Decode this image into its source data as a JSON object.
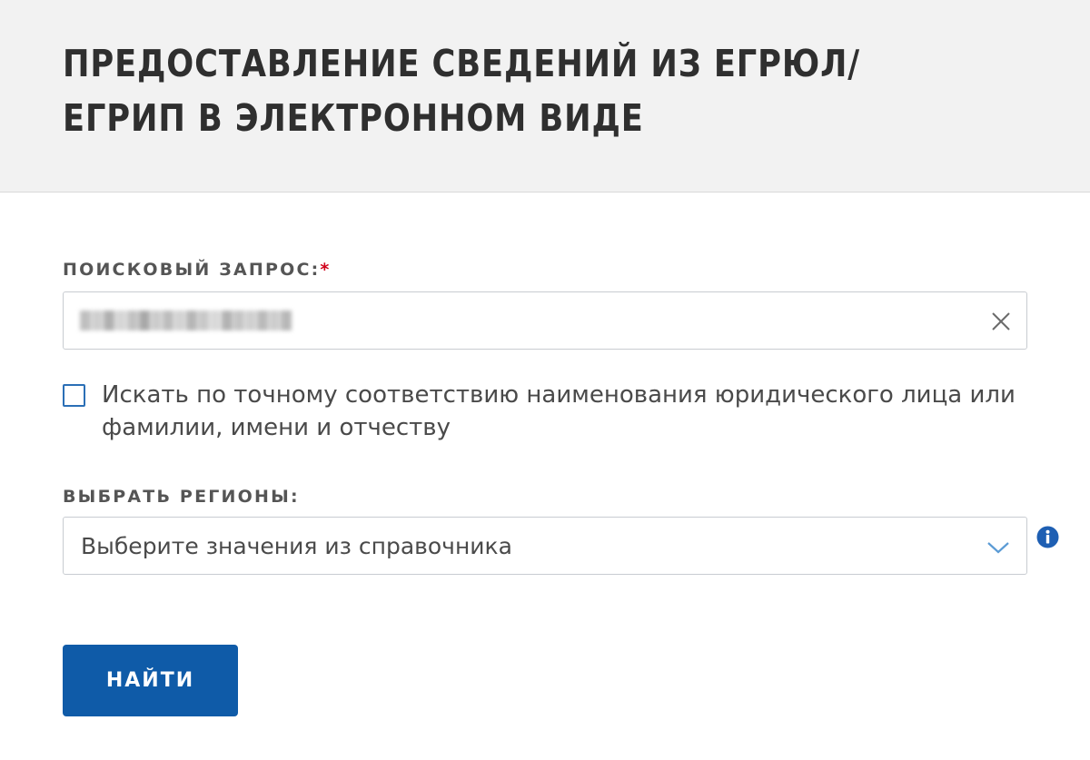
{
  "header": {
    "title": "ПРЕДОСТАВЛЕНИЕ СВЕДЕНИЙ ИЗ ЕГРЮЛ/ЕГРИП В ЭЛЕКТРОННОМ ВИДЕ"
  },
  "form": {
    "search": {
      "label": "ПОИСКОВЫЙ ЗАПРОС:",
      "required_mark": "*",
      "value_state": "blurred"
    },
    "exact_match": {
      "label": "Искать по точному соответствию наименования юридического лица или фамилии, имени и отчеству",
      "checked": false
    },
    "regions": {
      "label": "ВЫБРАТЬ РЕГИОНЫ:",
      "placeholder": "Выберите значения из справочника"
    },
    "submit_label": "НАЙТИ"
  },
  "icons": {
    "clear": "close-icon",
    "dropdown": "chevron-down-icon",
    "info": "info-icon"
  },
  "colors": {
    "header_bg": "#f2f2f2",
    "primary_button": "#0f5ba8",
    "checkbox_border": "#2b6fb6",
    "chevron": "#5b9bd5",
    "info": "#1e5fb3",
    "required": "#d0021b"
  }
}
